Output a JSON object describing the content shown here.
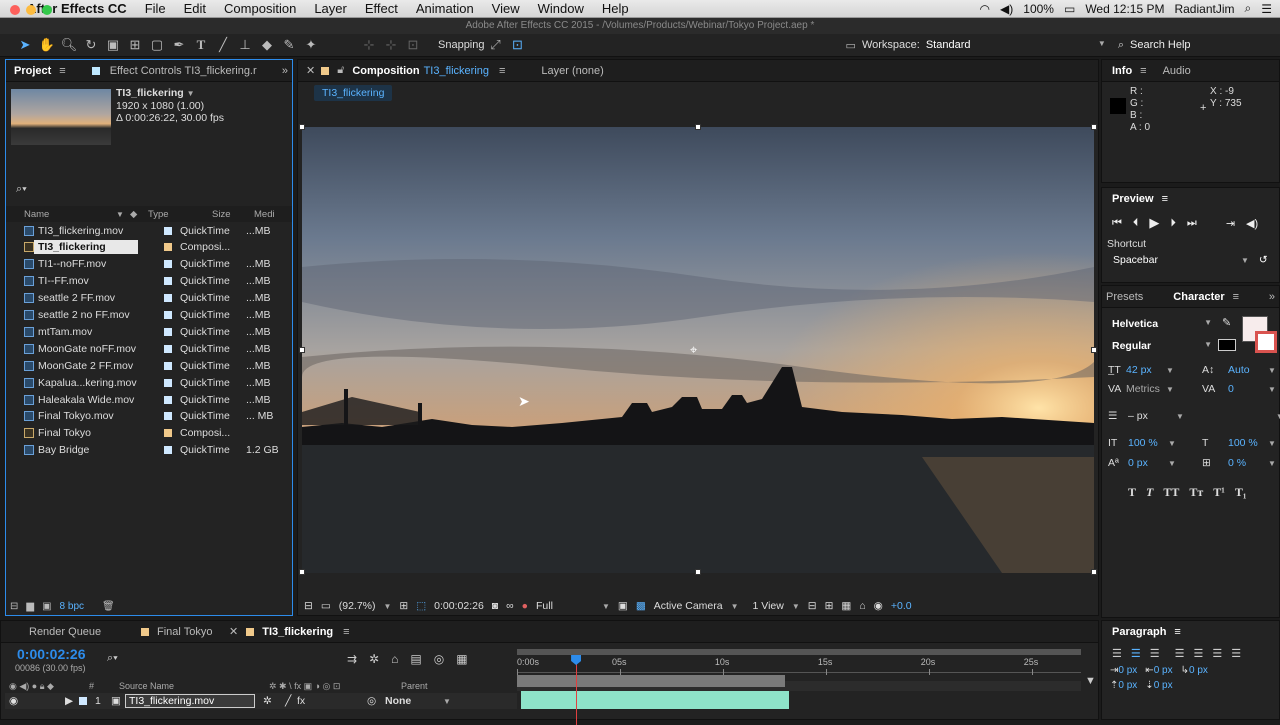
{
  "menubar": {
    "app": "After Effects CC",
    "items": [
      "File",
      "Edit",
      "Composition",
      "Layer",
      "Effect",
      "Animation",
      "View",
      "Window",
      "Help"
    ],
    "battery": "100%",
    "clock": "Wed 12:15 PM",
    "user": "RadiantJim"
  },
  "window_title": "Adobe After Effects CC 2015 - /Volumes/Products/Webinar/Tokyo Project.aep *",
  "toolbar": {
    "snapping_label": "Snapping",
    "workspace_label": "Workspace:",
    "workspace_value": "Standard",
    "search_help": "Search Help"
  },
  "project_panel": {
    "tab_project": "Project",
    "tab_effect_controls": "Effect Controls TI3_flickering.r",
    "selected_name": "TI3_flickering",
    "selected_dims": "1920 x 1080 (1.00)",
    "selected_duration": "Δ 0:00:26:22, 30.00 fps",
    "columns": {
      "name": "Name",
      "type": "Type",
      "size": "Size",
      "media": "Medi"
    },
    "items": [
      {
        "name": "TI3_flickering.mov",
        "type": "QuickTime",
        "size": "...MB",
        "label": "#cfe8ff",
        "kind": "footage"
      },
      {
        "name": "TI3_flickering",
        "type": "Composi...",
        "size": "",
        "label": "#f0c98a",
        "kind": "comp",
        "selected": true
      },
      {
        "name": "TI1--noFF.mov",
        "type": "QuickTime",
        "size": "...MB",
        "label": "#cfe8ff",
        "kind": "footage"
      },
      {
        "name": "TI--FF.mov",
        "type": "QuickTime",
        "size": "...MB",
        "label": "#cfe8ff",
        "kind": "footage"
      },
      {
        "name": "seattle 2 FF.mov",
        "type": "QuickTime",
        "size": "...MB",
        "label": "#cfe8ff",
        "kind": "footage"
      },
      {
        "name": "seattle  2 no FF.mov",
        "type": "QuickTime",
        "size": "...MB",
        "label": "#cfe8ff",
        "kind": "footage"
      },
      {
        "name": "mtTam.mov",
        "type": "QuickTime",
        "size": "...MB",
        "label": "#cfe8ff",
        "kind": "footage"
      },
      {
        "name": "MoonGate noFF.mov",
        "type": "QuickTime",
        "size": "...MB",
        "label": "#cfe8ff",
        "kind": "footage"
      },
      {
        "name": "MoonGate 2 FF.mov",
        "type": "QuickTime",
        "size": "...MB",
        "label": "#cfe8ff",
        "kind": "footage"
      },
      {
        "name": "Kapalua...kering.mov",
        "type": "QuickTime",
        "size": "...MB",
        "label": "#cfe8ff",
        "kind": "footage"
      },
      {
        "name": "Haleakala Wide.mov",
        "type": "QuickTime",
        "size": "...MB",
        "label": "#cfe8ff",
        "kind": "footage"
      },
      {
        "name": "Final Tokyo.mov",
        "type": "QuickTime",
        "size": "... MB",
        "label": "#cfe8ff",
        "kind": "footage"
      },
      {
        "name": "Final Tokyo",
        "type": "Composi...",
        "size": "",
        "label": "#f0c98a",
        "kind": "comp"
      },
      {
        "name": "Bay Bridge",
        "type": "QuickTime",
        "size": "1.2 GB",
        "label": "#cfe8ff",
        "kind": "footage"
      }
    ],
    "bpc": "8 bpc"
  },
  "composition_panel": {
    "tab_label": "Composition",
    "comp_name": "TI3_flickering",
    "layer_tab": "Layer (none)",
    "crumb": "TI3_flickering",
    "zoom": "(92.7%)",
    "timecode": "0:00:02:26",
    "resolution": "Full",
    "camera": "Active Camera",
    "views": "1 View",
    "exposure": "+0.0"
  },
  "info_panel": {
    "tab_info": "Info",
    "tab_audio": "Audio",
    "r": "R :",
    "g": "G :",
    "b": "B :",
    "a": "A : 0",
    "x": "X : -9",
    "y": "Y : 735"
  },
  "preview_panel": {
    "title": "Preview",
    "shortcut_label": "Shortcut",
    "shortcut_value": "Spacebar"
  },
  "character_panel": {
    "tab_presets": "Presets",
    "tab_character": "Character",
    "font": "Helvetica",
    "style": "Regular",
    "size": "42 px",
    "leading": "Auto",
    "kerning": "Metrics",
    "tracking": "0",
    "stroke": "– px",
    "vscale": "100 %",
    "hscale": "100 %",
    "baseline": "0 px",
    "tsume": "0 %",
    "style_buttons": [
      "T",
      "T",
      "TT",
      "Tт",
      "T¹",
      "T₁"
    ]
  },
  "paragraph_panel": {
    "title": "Paragraph",
    "indent_left": "0 px",
    "indent_right": "0 px",
    "indent_first": "0 px",
    "space_before": "0 px",
    "space_after": "0 px"
  },
  "timeline": {
    "tab_render": "Render Queue",
    "tab_final": "Final Tokyo",
    "tab_active": "TI3_flickering",
    "current_time": "0:00:02:26",
    "frame_info": "00086 (30.00 fps)",
    "col_source": "Source Name",
    "col_parent": "Parent",
    "ruler": [
      "0:00s",
      "05s",
      "10s",
      "15s",
      "20s",
      "25s"
    ],
    "layer_index": "1",
    "layer_name": "TI3_flickering.mov",
    "parent_value": "None",
    "playhead_seconds": 2.87,
    "duration_seconds": 26.73,
    "work_area_end_seconds": 13
  }
}
